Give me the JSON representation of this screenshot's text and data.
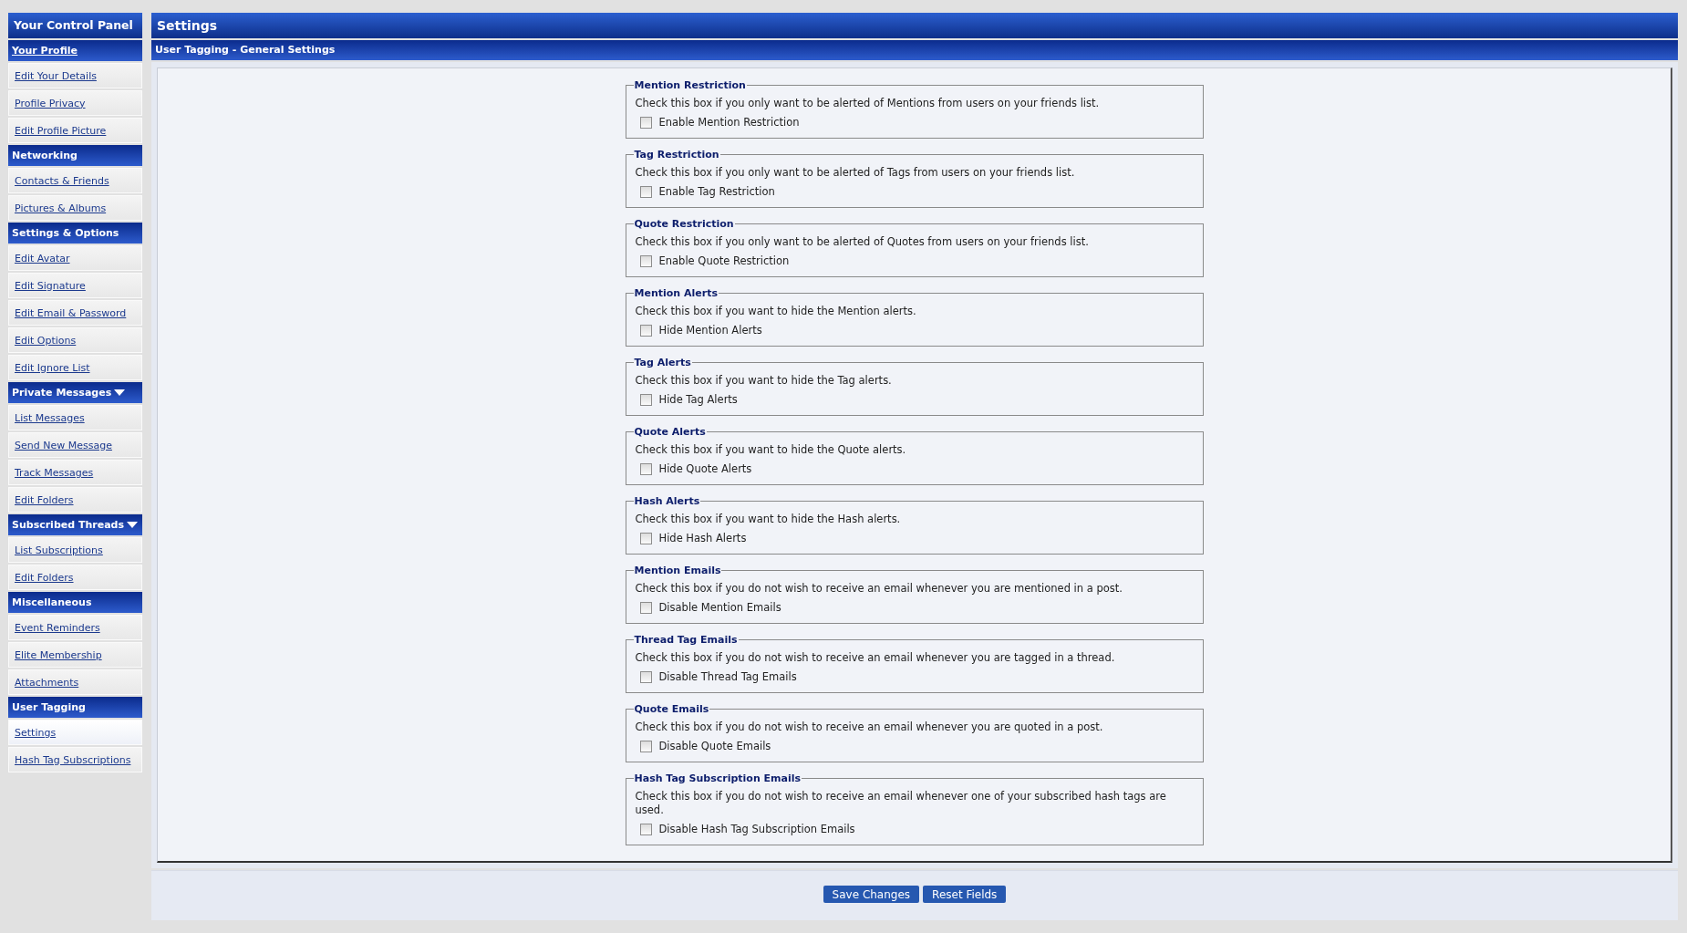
{
  "sidebar": {
    "title": "Your Control Panel",
    "sections": [
      {
        "title": "Your Profile",
        "link": true,
        "dropdown": false,
        "items": [
          {
            "label": "Edit Your Details",
            "selected": false
          },
          {
            "label": "Profile Privacy",
            "selected": false
          },
          {
            "label": "Edit Profile Picture",
            "selected": false
          }
        ]
      },
      {
        "title": "Networking",
        "link": false,
        "dropdown": false,
        "items": [
          {
            "label": "Contacts & Friends",
            "selected": false
          },
          {
            "label": "Pictures & Albums",
            "selected": false
          }
        ]
      },
      {
        "title": "Settings & Options",
        "link": false,
        "dropdown": false,
        "items": [
          {
            "label": "Edit Avatar",
            "selected": false
          },
          {
            "label": "Edit Signature",
            "selected": false
          },
          {
            "label": "Edit Email & Password",
            "selected": false
          },
          {
            "label": "Edit Options",
            "selected": false
          },
          {
            "label": "Edit Ignore List",
            "selected": false
          }
        ]
      },
      {
        "title": "Private Messages",
        "link": false,
        "dropdown": true,
        "items": [
          {
            "label": "List Messages",
            "selected": false
          },
          {
            "label": "Send New Message",
            "selected": false
          },
          {
            "label": "Track Messages",
            "selected": false
          },
          {
            "label": "Edit Folders",
            "selected": false
          }
        ]
      },
      {
        "title": "Subscribed Threads",
        "link": false,
        "dropdown": true,
        "items": [
          {
            "label": "List Subscriptions",
            "selected": false
          },
          {
            "label": "Edit Folders",
            "selected": false
          }
        ]
      },
      {
        "title": "Miscellaneous",
        "link": false,
        "dropdown": false,
        "items": [
          {
            "label": "Event Reminders",
            "selected": false
          },
          {
            "label": "Elite Membership",
            "selected": false
          },
          {
            "label": "Attachments",
            "selected": false
          }
        ]
      },
      {
        "title": "User Tagging",
        "link": false,
        "dropdown": false,
        "items": [
          {
            "label": "Settings",
            "selected": true
          },
          {
            "label": "Hash Tag Subscriptions",
            "selected": false
          }
        ]
      }
    ]
  },
  "main": {
    "title": "Settings",
    "subtitle": "User Tagging - General Settings",
    "groups": [
      {
        "legend": "Mention Restriction",
        "description": "Check this box if you only want to be alerted of Mentions from users on your friends list.",
        "option": "Enable Mention Restriction",
        "checked": false
      },
      {
        "legend": "Tag Restriction",
        "description": "Check this box if you only want to be alerted of Tags from users on your friends list.",
        "option": "Enable Tag Restriction",
        "checked": false
      },
      {
        "legend": "Quote Restriction",
        "description": "Check this box if you only want to be alerted of Quotes from users on your friends list.",
        "option": "Enable Quote Restriction",
        "checked": false
      },
      {
        "legend": "Mention Alerts",
        "description": "Check this box if you want to hide the Mention alerts.",
        "option": "Hide Mention Alerts",
        "checked": false
      },
      {
        "legend": "Tag Alerts",
        "description": "Check this box if you want to hide the Tag alerts.",
        "option": "Hide Tag Alerts",
        "checked": false
      },
      {
        "legend": "Quote Alerts",
        "description": "Check this box if you want to hide the Quote alerts.",
        "option": "Hide Quote Alerts",
        "checked": false
      },
      {
        "legend": "Hash Alerts",
        "description": "Check this box if you want to hide the Hash alerts.",
        "option": "Hide Hash Alerts",
        "checked": false
      },
      {
        "legend": "Mention Emails",
        "description": "Check this box if you do not wish to receive an email whenever you are mentioned in a post.",
        "option": "Disable Mention Emails",
        "checked": false
      },
      {
        "legend": "Thread Tag Emails",
        "description": "Check this box if you do not wish to receive an email whenever you are tagged in a thread.",
        "option": "Disable Thread Tag Emails",
        "checked": false
      },
      {
        "legend": "Quote Emails",
        "description": "Check this box if you do not wish to receive an email whenever you are quoted in a post.",
        "option": "Disable Quote Emails",
        "checked": false
      },
      {
        "legend": "Hash Tag Subscription Emails",
        "description": "Check this box if you do not wish to receive an email whenever one of your subscribed hash tags are used.",
        "option": "Disable Hash Tag Subscription Emails",
        "checked": false
      }
    ],
    "buttons": [
      "Save Changes",
      "Reset Fields"
    ]
  }
}
